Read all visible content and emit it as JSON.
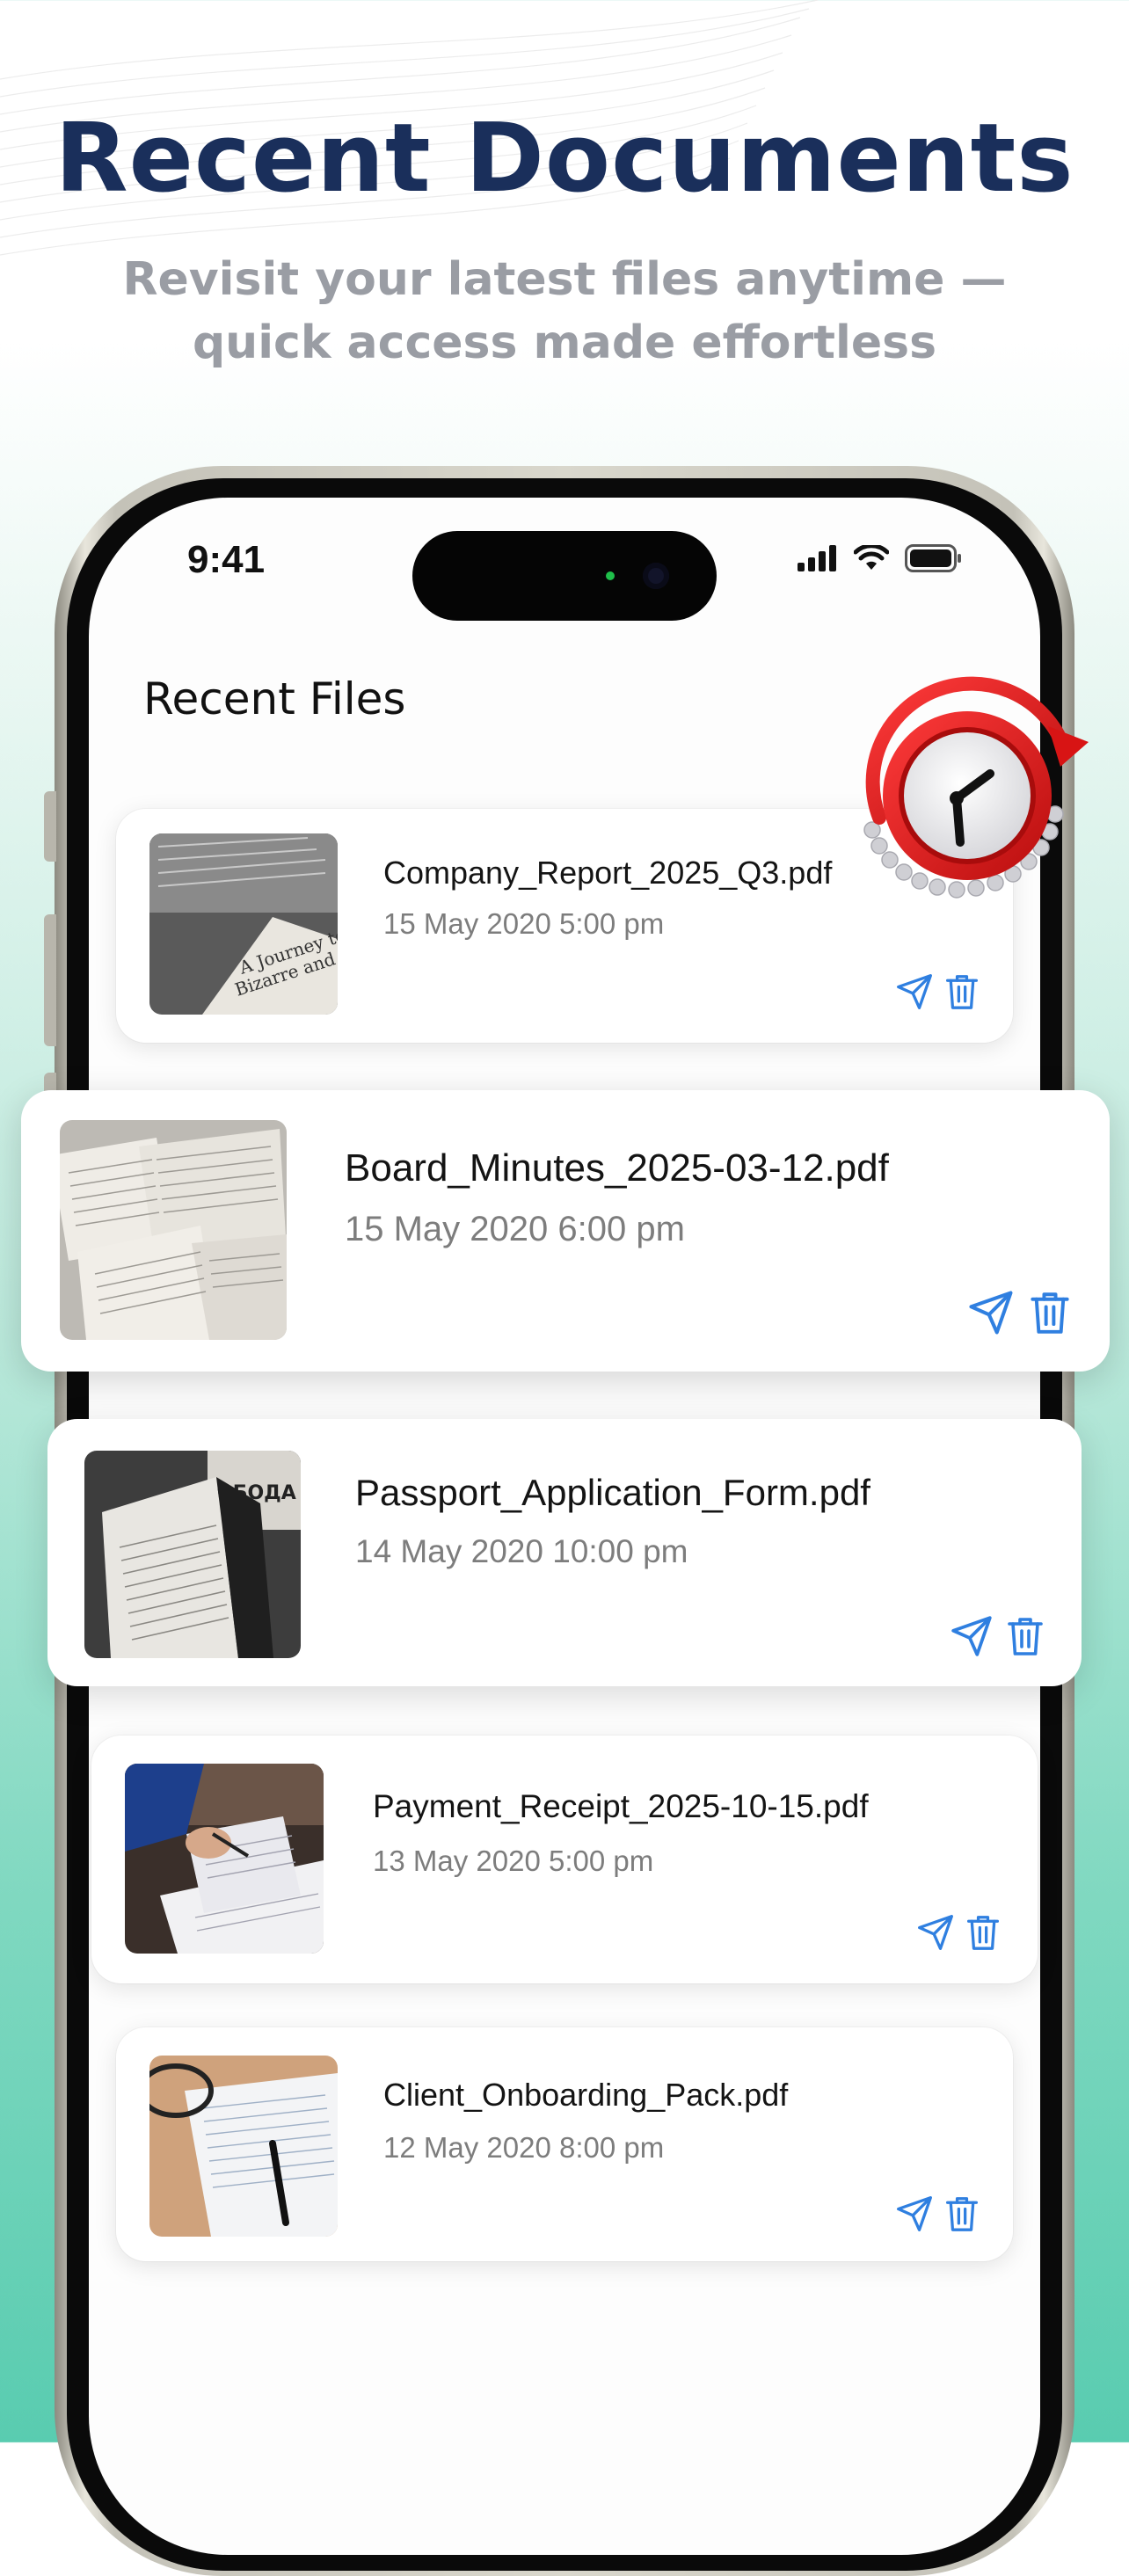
{
  "hero": {
    "title": "Recent Documents",
    "subtitle_line1": "Revisit your latest files anytime —",
    "subtitle_line2": "quick access made effortless"
  },
  "status_bar": {
    "time": "9:41"
  },
  "screen": {
    "title": "Recent Files"
  },
  "files": [
    {
      "name": "Company_Report_2025_Q3.pdf",
      "date": "15 May 2020 5:00 pm"
    },
    {
      "name": "Board_Minutes_2025-03-12.pdf",
      "date": "15 May 2020 6:00 pm"
    },
    {
      "name": "Passport_Application_Form.pdf",
      "date": "14 May 2020 10:00 pm"
    },
    {
      "name": "Payment_Receipt_2025-10-15.pdf",
      "date": "13 May 2020 5:00 pm"
    },
    {
      "name": "Client_Onboarding_Pack.pdf",
      "date": "12 May 2020 8:00 pm"
    }
  ],
  "icons": {
    "share": "send-icon",
    "delete": "trash-icon",
    "badge": "clock-icon"
  },
  "colors": {
    "hero_title": "#1a2f5b",
    "hero_subtitle": "#9a9da4",
    "action_blue": "#2f7fe0",
    "badge_red": "#e31b1b",
    "bg_teal": "#59ccb0"
  }
}
